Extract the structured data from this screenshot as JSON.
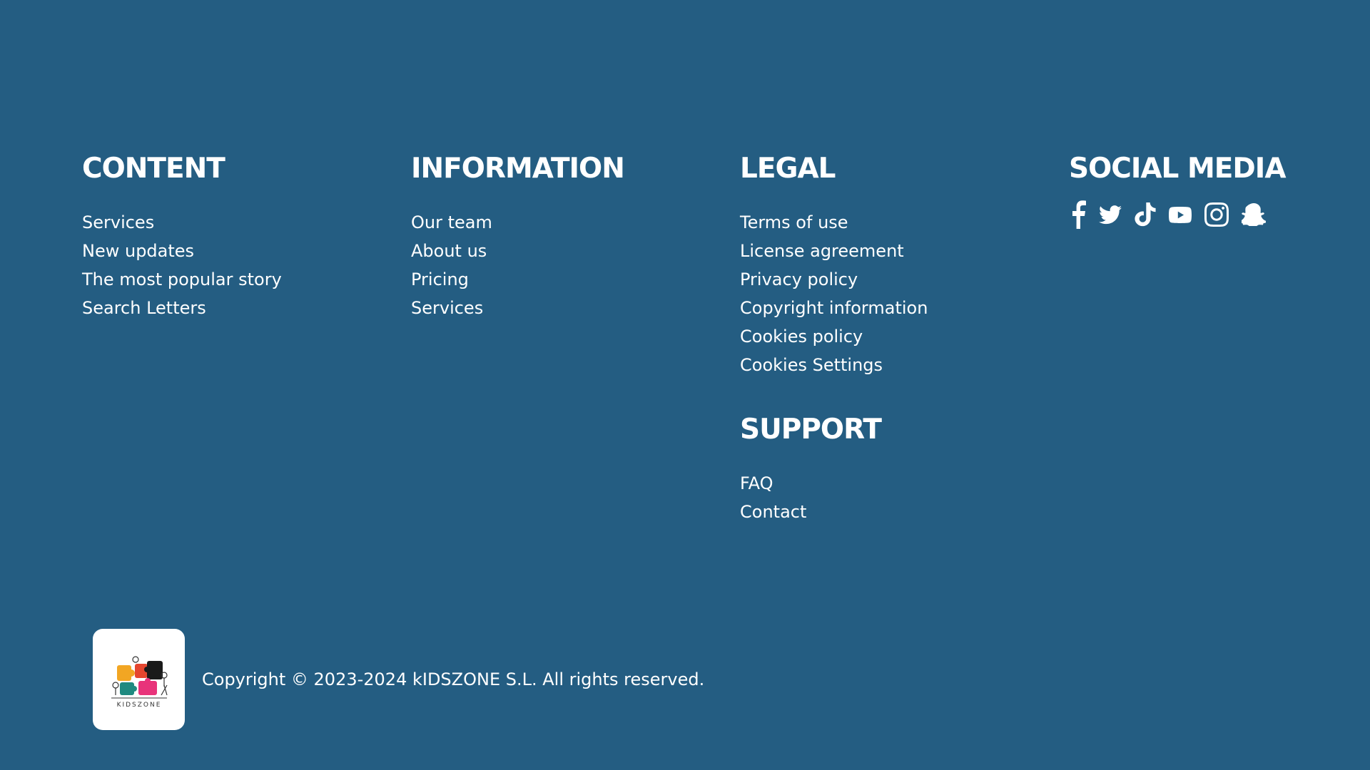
{
  "columns": {
    "content": {
      "title": "CONTENT",
      "links": [
        "Services",
        "New updates",
        "The most popular story",
        "Search Letters"
      ]
    },
    "information": {
      "title": "INFORMATION",
      "links": [
        "Our team",
        "About us",
        "Pricing",
        "Services"
      ]
    },
    "legal": {
      "title": "LEGAL",
      "links": [
        "Terms of use",
        "License agreement",
        "Privacy policy",
        "Copyright information",
        "Cookies policy",
        "Cookies Settings"
      ]
    },
    "support": {
      "title": "SUPPORT",
      "links": [
        "FAQ",
        "Contact"
      ]
    },
    "social": {
      "title": "SOCIAL MEDIA",
      "icons": [
        "facebook-icon",
        "twitter-icon",
        "tiktok-icon",
        "youtube-icon",
        "instagram-icon",
        "snapchat-icon"
      ]
    }
  },
  "footer": {
    "logo_text": "KIDSZONE",
    "copyright": "Copyright © 2023-2024 kIDSZONE S.L. All rights reserved."
  },
  "colors": {
    "background": "#245d82",
    "text": "#ffffff"
  }
}
